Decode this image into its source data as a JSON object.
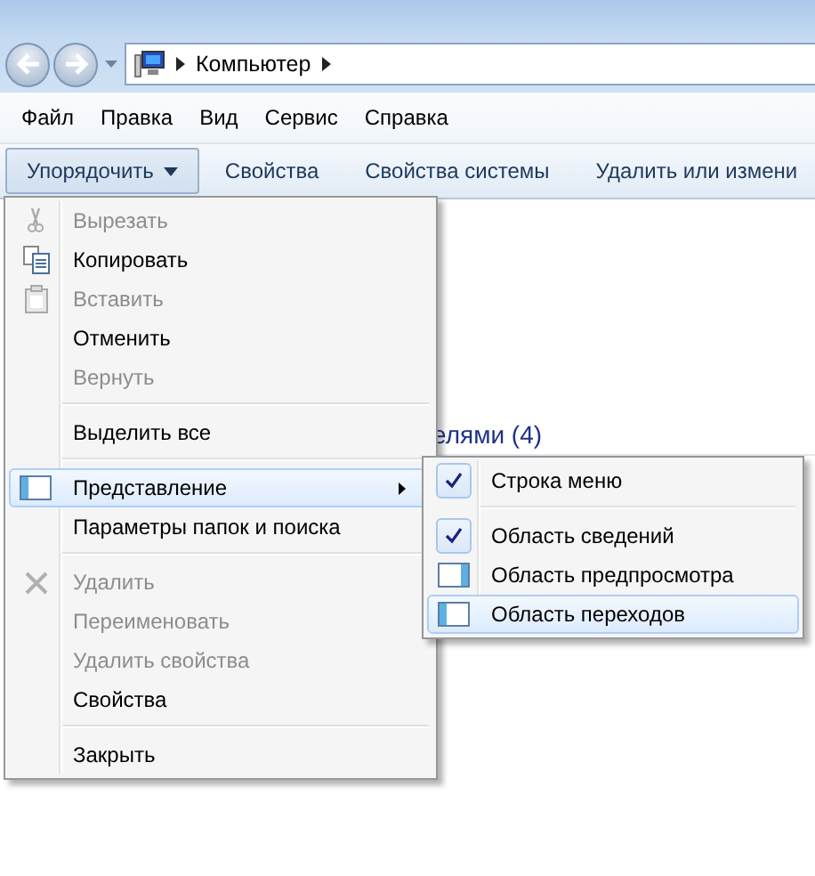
{
  "address_bar": {
    "path": [
      "Компьютер"
    ]
  },
  "menu_bar": [
    "Файл",
    "Правка",
    "Вид",
    "Сервис",
    "Справка"
  ],
  "toolbar": [
    {
      "label": "Упорядочить",
      "selected": true,
      "dropdown": true
    },
    {
      "label": "Свойства",
      "selected": false,
      "dropdown": false
    },
    {
      "label": "Свойства системы",
      "selected": false,
      "dropdown": false
    },
    {
      "label": "Удалить или измени",
      "selected": false,
      "dropdown": false
    }
  ],
  "content": {
    "group_header": "елями (4)"
  },
  "context_menu": [
    {
      "kind": "item",
      "label": "Вырезать",
      "disabled": true,
      "selected": false,
      "submenu": false
    },
    {
      "kind": "item",
      "label": "Копировать",
      "disabled": false,
      "selected": false,
      "submenu": false
    },
    {
      "kind": "item",
      "label": "Вставить",
      "disabled": true,
      "selected": false,
      "submenu": false
    },
    {
      "kind": "item",
      "label": "Отменить",
      "disabled": false,
      "selected": false,
      "submenu": false
    },
    {
      "kind": "item",
      "label": "Вернуть",
      "disabled": true,
      "selected": false,
      "submenu": false
    },
    {
      "kind": "separator"
    },
    {
      "kind": "item",
      "label": "Выделить все",
      "disabled": false,
      "selected": false,
      "submenu": false
    },
    {
      "kind": "separator"
    },
    {
      "kind": "item",
      "label": "Представление",
      "disabled": false,
      "selected": true,
      "submenu": true
    },
    {
      "kind": "item",
      "label": "Параметры папок и поиска",
      "disabled": false,
      "selected": false,
      "submenu": false
    },
    {
      "kind": "separator"
    },
    {
      "kind": "item",
      "label": "Удалить",
      "disabled": true,
      "selected": false,
      "submenu": false
    },
    {
      "kind": "item",
      "label": "Переименовать",
      "disabled": true,
      "selected": false,
      "submenu": false
    },
    {
      "kind": "item",
      "label": "Удалить свойства",
      "disabled": true,
      "selected": false,
      "submenu": false
    },
    {
      "kind": "item",
      "label": "Свойства",
      "disabled": false,
      "selected": false,
      "submenu": false
    },
    {
      "kind": "separator"
    },
    {
      "kind": "item",
      "label": "Закрыть",
      "disabled": false,
      "selected": false,
      "submenu": false
    }
  ],
  "submenu": [
    {
      "kind": "item",
      "label": "Строка меню",
      "checked": true,
      "selected": false
    },
    {
      "kind": "separator"
    },
    {
      "kind": "item",
      "label": "Область сведений",
      "checked": true,
      "selected": false
    },
    {
      "kind": "item",
      "label": "Область предпросмотра",
      "checked": false,
      "selected": false
    },
    {
      "kind": "item",
      "label": "Область переходов",
      "checked": false,
      "selected": true
    }
  ]
}
